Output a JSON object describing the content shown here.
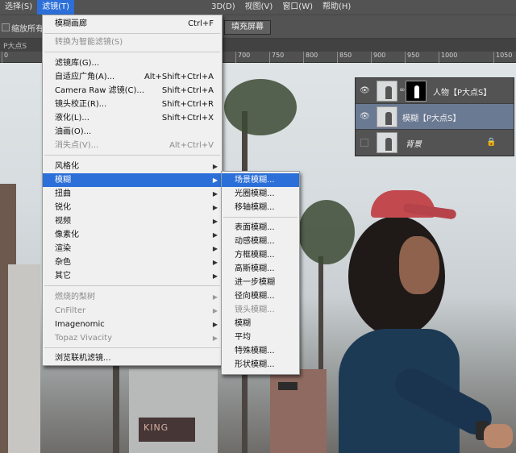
{
  "menubar": {
    "items": [
      {
        "label": "选择(S)"
      },
      {
        "label": "滤镜(T)",
        "active": true
      },
      {
        "label": "3D(D)"
      },
      {
        "label": "视图(V)"
      },
      {
        "label": "窗口(W)"
      },
      {
        "label": "帮助(H)"
      }
    ]
  },
  "optionsbar": {
    "checkbox_label": "缩放所有",
    "fill_screen": "填充屏幕"
  },
  "document": {
    "tab_label": "P大点S"
  },
  "ruler": {
    "ticks": [
      "0",
      "700",
      "750",
      "800",
      "850",
      "900",
      "950",
      "1000",
      "1050"
    ]
  },
  "canvas": {
    "sign_text": "KING"
  },
  "layers": {
    "items": [
      {
        "name": "人物【P大点S】",
        "visible": true,
        "has_mask": true,
        "selected": false
      },
      {
        "name": "模糊【P大点S】",
        "visible": true,
        "has_mask": false,
        "selected": true
      },
      {
        "name": "背景",
        "visible": false,
        "has_mask": false,
        "selected": false,
        "locked": true
      }
    ]
  },
  "filter_menu": {
    "items": [
      {
        "label": "模糊画廊",
        "shortcut": "Ctrl+F"
      },
      {
        "label": "转换为智能滤镜(S)",
        "disabled": true
      },
      {
        "label": "滤镜库(G)..."
      },
      {
        "label": "自适应广角(A)...",
        "shortcut": "Alt+Shift+Ctrl+A"
      },
      {
        "label": "Camera Raw 滤镜(C)...",
        "shortcut": "Shift+Ctrl+A"
      },
      {
        "label": "镜头校正(R)...",
        "shortcut": "Shift+Ctrl+R"
      },
      {
        "label": "液化(L)...",
        "shortcut": "Shift+Ctrl+X"
      },
      {
        "label": "油画(O)..."
      },
      {
        "label": "消失点(V)...",
        "shortcut": "Alt+Ctrl+V",
        "disabled": true
      },
      {
        "label": "风格化"
      },
      {
        "label": "模糊",
        "highlighted": true
      },
      {
        "label": "扭曲"
      },
      {
        "label": "锐化"
      },
      {
        "label": "视频"
      },
      {
        "label": "像素化"
      },
      {
        "label": "渲染"
      },
      {
        "label": "杂色"
      },
      {
        "label": "其它"
      },
      {
        "label": "燃烧的梨树",
        "disabled": true
      },
      {
        "label": "CnFilter",
        "disabled": true
      },
      {
        "label": "Imagenomic"
      },
      {
        "label": "Topaz Vivacity",
        "disabled": true
      },
      {
        "label": "浏览联机滤镜..."
      }
    ]
  },
  "blur_submenu": {
    "items": [
      {
        "label": "场景模糊...",
        "highlighted": true
      },
      {
        "label": "光圈模糊..."
      },
      {
        "label": "移轴模糊..."
      },
      {
        "label": "表面模糊..."
      },
      {
        "label": "动感模糊..."
      },
      {
        "label": "方框模糊..."
      },
      {
        "label": "高斯模糊..."
      },
      {
        "label": "进一步模糊"
      },
      {
        "label": "径向模糊..."
      },
      {
        "label": "镜头模糊...",
        "disabled": true
      },
      {
        "label": "模糊"
      },
      {
        "label": "平均"
      },
      {
        "label": "特殊模糊..."
      },
      {
        "label": "形状模糊..."
      }
    ]
  },
  "icons": {
    "eye": "eye-icon",
    "chain": "chain-link-icon",
    "lock": "lock-icon",
    "submenu_arrow": "chevron-right-icon"
  }
}
